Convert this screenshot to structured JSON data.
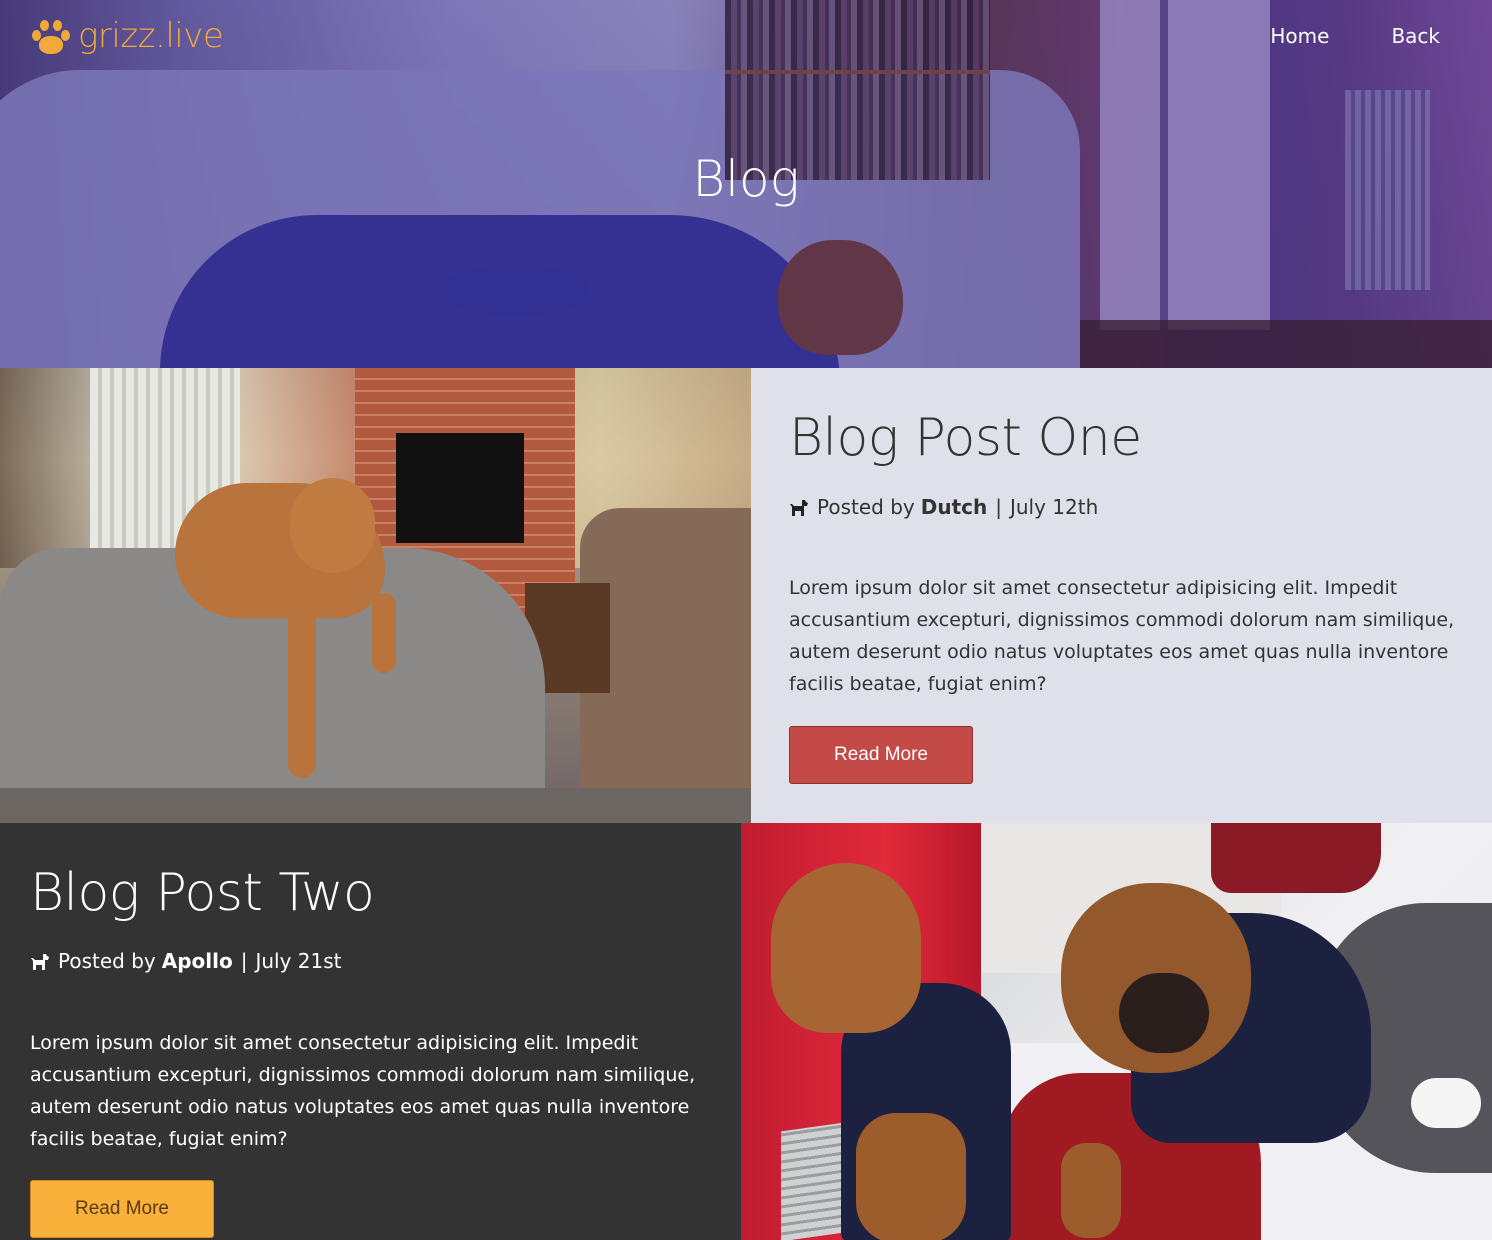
{
  "brand": {
    "name": "grizz.live",
    "color": "#f0a93a",
    "icon": "paw-icon"
  },
  "nav": {
    "links": [
      {
        "label": "Home"
      },
      {
        "label": "Back"
      }
    ]
  },
  "hero": {
    "title": "Blog"
  },
  "posts": [
    {
      "title": "Blog Post One",
      "posted_by_label": "Posted by",
      "author": "Dutch",
      "separator": "|",
      "date": "July 12th",
      "icon": "dog-icon",
      "body": "Lorem ipsum dolor sit amet consectetur adipisicing elit. Impedit accusantium excepturi, dignissimos commodi dolorum nam similique, autem deserunt odio natus voluptates eos amet quas nulla inventore facilis beatae, fugiat enim?",
      "button_label": "Read More",
      "button_color": "#c44a48",
      "panel_color": "#dfe0e9"
    },
    {
      "title": "Blog Post Two",
      "posted_by_label": "Posted by",
      "author": "Apollo",
      "separator": "|",
      "date": "July 21st",
      "icon": "dog-icon",
      "body": "Lorem ipsum dolor sit amet consectetur adipisicing elit. Impedit accusantium excepturi, dignissimos commodi dolorum nam similique, autem deserunt odio natus voluptates eos amet quas nulla inventore facilis beatae, fugiat enim?",
      "button_label": "Read More",
      "button_color": "#f9b13c",
      "panel_color": "#333333"
    }
  ]
}
